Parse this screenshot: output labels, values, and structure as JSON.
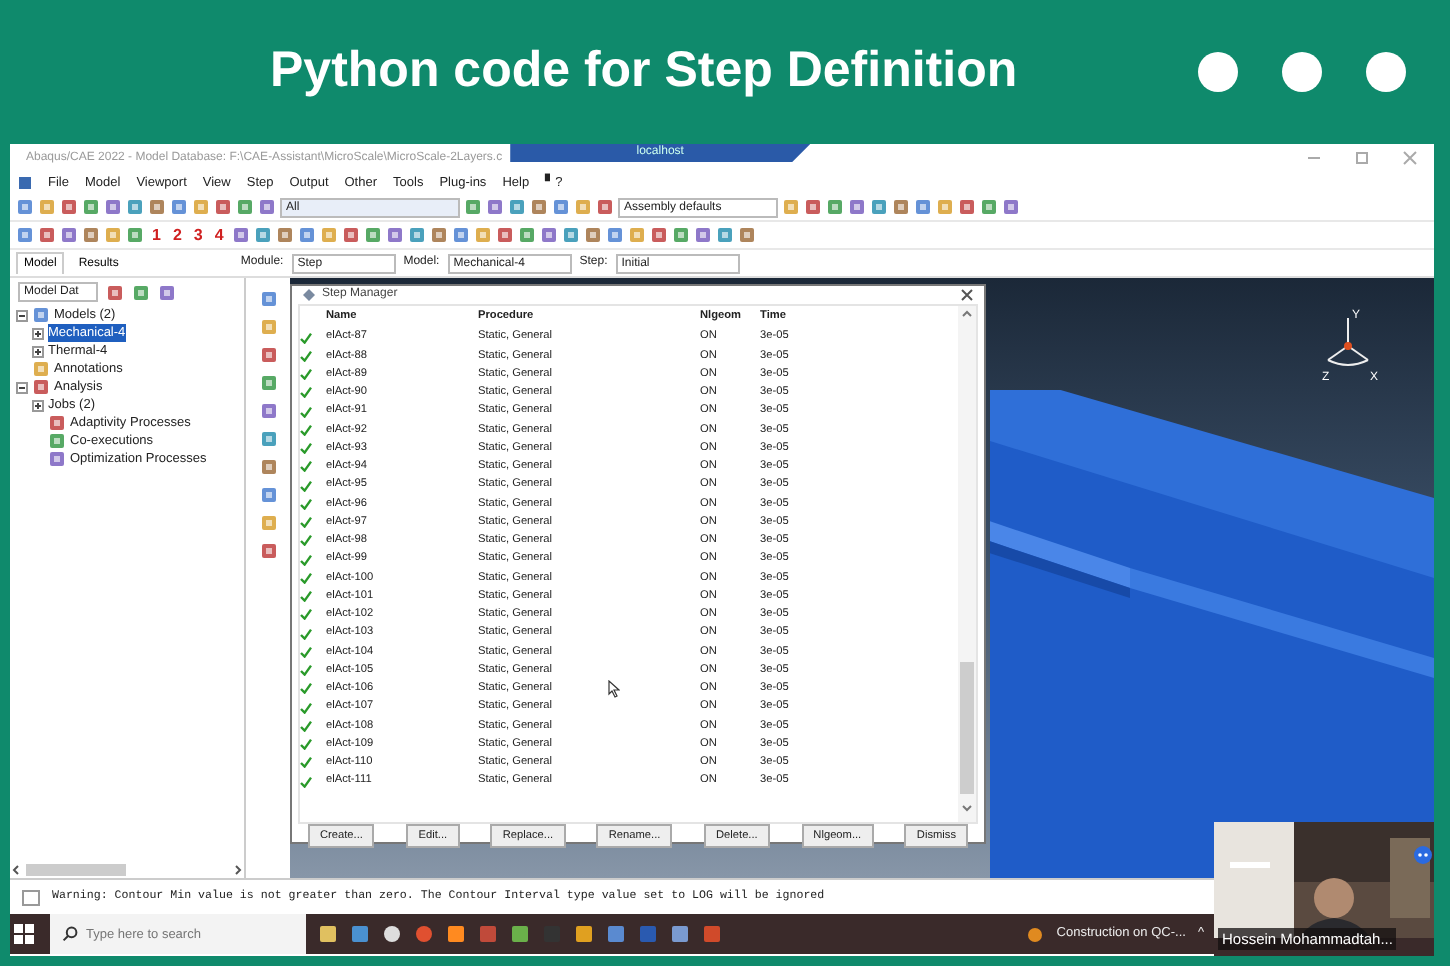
{
  "banner": {
    "title": "Python code for Step Definition"
  },
  "app": {
    "window_title": "Abaqus/CAE 2022 - Model Database: F:\\CAE-Assistant\\MicroScale\\MicroScale-2Layers.c",
    "remote_title": "localhost",
    "menu": [
      "File",
      "Model",
      "Viewport",
      "View",
      "Step",
      "Output",
      "Other",
      "Tools",
      "Plug-ins",
      "Help",
      "▘?"
    ],
    "selection_filter": "All",
    "render_style": "Assembly defaults",
    "view_numbers": [
      "1",
      "2",
      "3",
      "4"
    ],
    "tabs": [
      {
        "label": "Model",
        "selected": true
      },
      {
        "label": "Results",
        "selected": false
      }
    ],
    "context": [
      {
        "label": "Module:",
        "value": "Step"
      },
      {
        "label": "Model:",
        "value": "Mechanical-4"
      },
      {
        "label": "Step:",
        "value": "Initial"
      }
    ],
    "tree_source": "Model Dat",
    "tree": [
      {
        "label": "Models (2)",
        "expanded": true,
        "selected": false,
        "children": [
          {
            "label": "Mechanical-4",
            "expanded": false,
            "selected": true
          },
          {
            "label": "Thermal-4",
            "expanded": false,
            "selected": false
          }
        ]
      },
      {
        "label": "Annotations",
        "selected": false
      },
      {
        "label": "Analysis",
        "expanded": true,
        "selected": false,
        "children": [
          {
            "label": "Jobs (2)",
            "expanded": false,
            "selected": false
          },
          {
            "label": "Adaptivity Processes",
            "selected": false
          },
          {
            "label": "Co-executions",
            "selected": false
          },
          {
            "label": "Optimization Processes",
            "selected": false
          }
        ]
      }
    ],
    "triad": [
      "Y",
      "Z",
      "X"
    ],
    "dialog": {
      "title": "Step Manager",
      "columns": [
        "Name",
        "Procedure",
        "Nlgeom",
        "Time"
      ],
      "rows": [
        {
          "name": "elAct-87",
          "procedure": "Static, General",
          "nlgeom": "ON",
          "time": "3e-05",
          "active": true
        },
        {
          "name": "elAct-88",
          "procedure": "Static, General",
          "nlgeom": "ON",
          "time": "3e-05",
          "active": true
        },
        {
          "name": "elAct-89",
          "procedure": "Static, General",
          "nlgeom": "ON",
          "time": "3e-05",
          "active": true
        },
        {
          "name": "elAct-90",
          "procedure": "Static, General",
          "nlgeom": "ON",
          "time": "3e-05",
          "active": true
        },
        {
          "name": "elAct-91",
          "procedure": "Static, General",
          "nlgeom": "ON",
          "time": "3e-05",
          "active": true
        },
        {
          "name": "elAct-92",
          "procedure": "Static, General",
          "nlgeom": "ON",
          "time": "3e-05",
          "active": true
        },
        {
          "name": "elAct-93",
          "procedure": "Static, General",
          "nlgeom": "ON",
          "time": "3e-05",
          "active": true
        },
        {
          "name": "elAct-94",
          "procedure": "Static, General",
          "nlgeom": "ON",
          "time": "3e-05",
          "active": true
        },
        {
          "name": "elAct-95",
          "procedure": "Static, General",
          "nlgeom": "ON",
          "time": "3e-05",
          "active": true
        },
        {
          "name": "elAct-96",
          "procedure": "Static, General",
          "nlgeom": "ON",
          "time": "3e-05",
          "active": true
        },
        {
          "name": "elAct-97",
          "procedure": "Static, General",
          "nlgeom": "ON",
          "time": "3e-05",
          "active": true
        },
        {
          "name": "elAct-98",
          "procedure": "Static, General",
          "nlgeom": "ON",
          "time": "3e-05",
          "active": true
        },
        {
          "name": "elAct-99",
          "procedure": "Static, General",
          "nlgeom": "ON",
          "time": "3e-05",
          "active": true
        },
        {
          "name": "elAct-100",
          "procedure": "Static, General",
          "nlgeom": "ON",
          "time": "3e-05",
          "active": true
        },
        {
          "name": "elAct-101",
          "procedure": "Static, General",
          "nlgeom": "ON",
          "time": "3e-05",
          "active": true
        },
        {
          "name": "elAct-102",
          "procedure": "Static, General",
          "nlgeom": "ON",
          "time": "3e-05",
          "active": true
        },
        {
          "name": "elAct-103",
          "procedure": "Static, General",
          "nlgeom": "ON",
          "time": "3e-05",
          "active": true
        },
        {
          "name": "elAct-104",
          "procedure": "Static, General",
          "nlgeom": "ON",
          "time": "3e-05",
          "active": true
        },
        {
          "name": "elAct-105",
          "procedure": "Static, General",
          "nlgeom": "ON",
          "time": "3e-05",
          "active": true
        },
        {
          "name": "elAct-106",
          "procedure": "Static, General",
          "nlgeom": "ON",
          "time": "3e-05",
          "active": true
        },
        {
          "name": "elAct-107",
          "procedure": "Static, General",
          "nlgeom": "ON",
          "time": "3e-05",
          "active": true
        },
        {
          "name": "elAct-108",
          "procedure": "Static, General",
          "nlgeom": "ON",
          "time": "3e-05",
          "active": true
        },
        {
          "name": "elAct-109",
          "procedure": "Static, General",
          "nlgeom": "ON",
          "time": "3e-05",
          "active": true
        },
        {
          "name": "elAct-110",
          "procedure": "Static, General",
          "nlgeom": "ON",
          "time": "3e-05",
          "active": true
        },
        {
          "name": "elAct-111",
          "procedure": "Static, General",
          "nlgeom": "ON",
          "time": "3e-05",
          "active": true
        }
      ],
      "buttons": [
        "Create...",
        "Edit...",
        "Replace...",
        "Rename...",
        "Delete...",
        "Nlgeom...",
        "Dismiss"
      ]
    },
    "message": "Warning: Contour Min value is not greater than zero. The Contour Interval type value set to LOG will be ignored"
  },
  "taskbar": {
    "search_placeholder": "Type here to search",
    "app_label": "Construction on QC-...",
    "tray": "^"
  },
  "webcam": {
    "kind": "picture",
    "name": "Hossein Mohammadtah..."
  }
}
